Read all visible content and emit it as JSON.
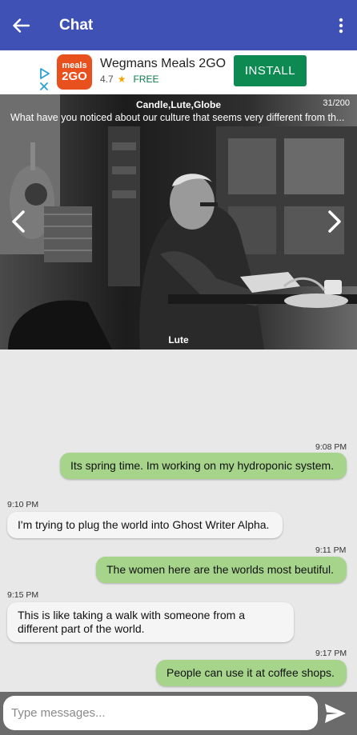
{
  "appbar": {
    "title": "Chat"
  },
  "ad": {
    "logo_line1": "meals",
    "logo_line2": "2GO",
    "name": "Wegmans Meals 2GO",
    "rating": "4.7",
    "price": "FREE",
    "install_label": "INSTALL"
  },
  "photo": {
    "tags": "Candle,Lute,Globe",
    "counter": "31/200",
    "question": "What have you noticed about our culture that seems very different from  th...",
    "caption": "Lute"
  },
  "messages": [
    {
      "time": "9:08 PM",
      "text": "Its spring time.  Im working on my hydroponic system.",
      "side": "out"
    },
    {
      "time": "9:10 PM",
      "text": "I'm trying to plug the world into Ghost Writer Alpha.",
      "side": "in"
    },
    {
      "time": "9:11 PM",
      "text": "The women here are the worlds most beutiful.",
      "side": "out"
    },
    {
      "time": "9:15 PM",
      "text": "This is like taking a walk with someone from a different part of the world.",
      "side": "in"
    },
    {
      "time": "9:17 PM",
      "text": "People can use it at coffee shops.",
      "side": "out"
    }
  ],
  "composer": {
    "placeholder": "Type messages..."
  },
  "colors": {
    "appbar": "#3f51b5",
    "outgoing": "#a5d48a",
    "incoming": "#f5f5f5",
    "install": "#0d8a52"
  }
}
